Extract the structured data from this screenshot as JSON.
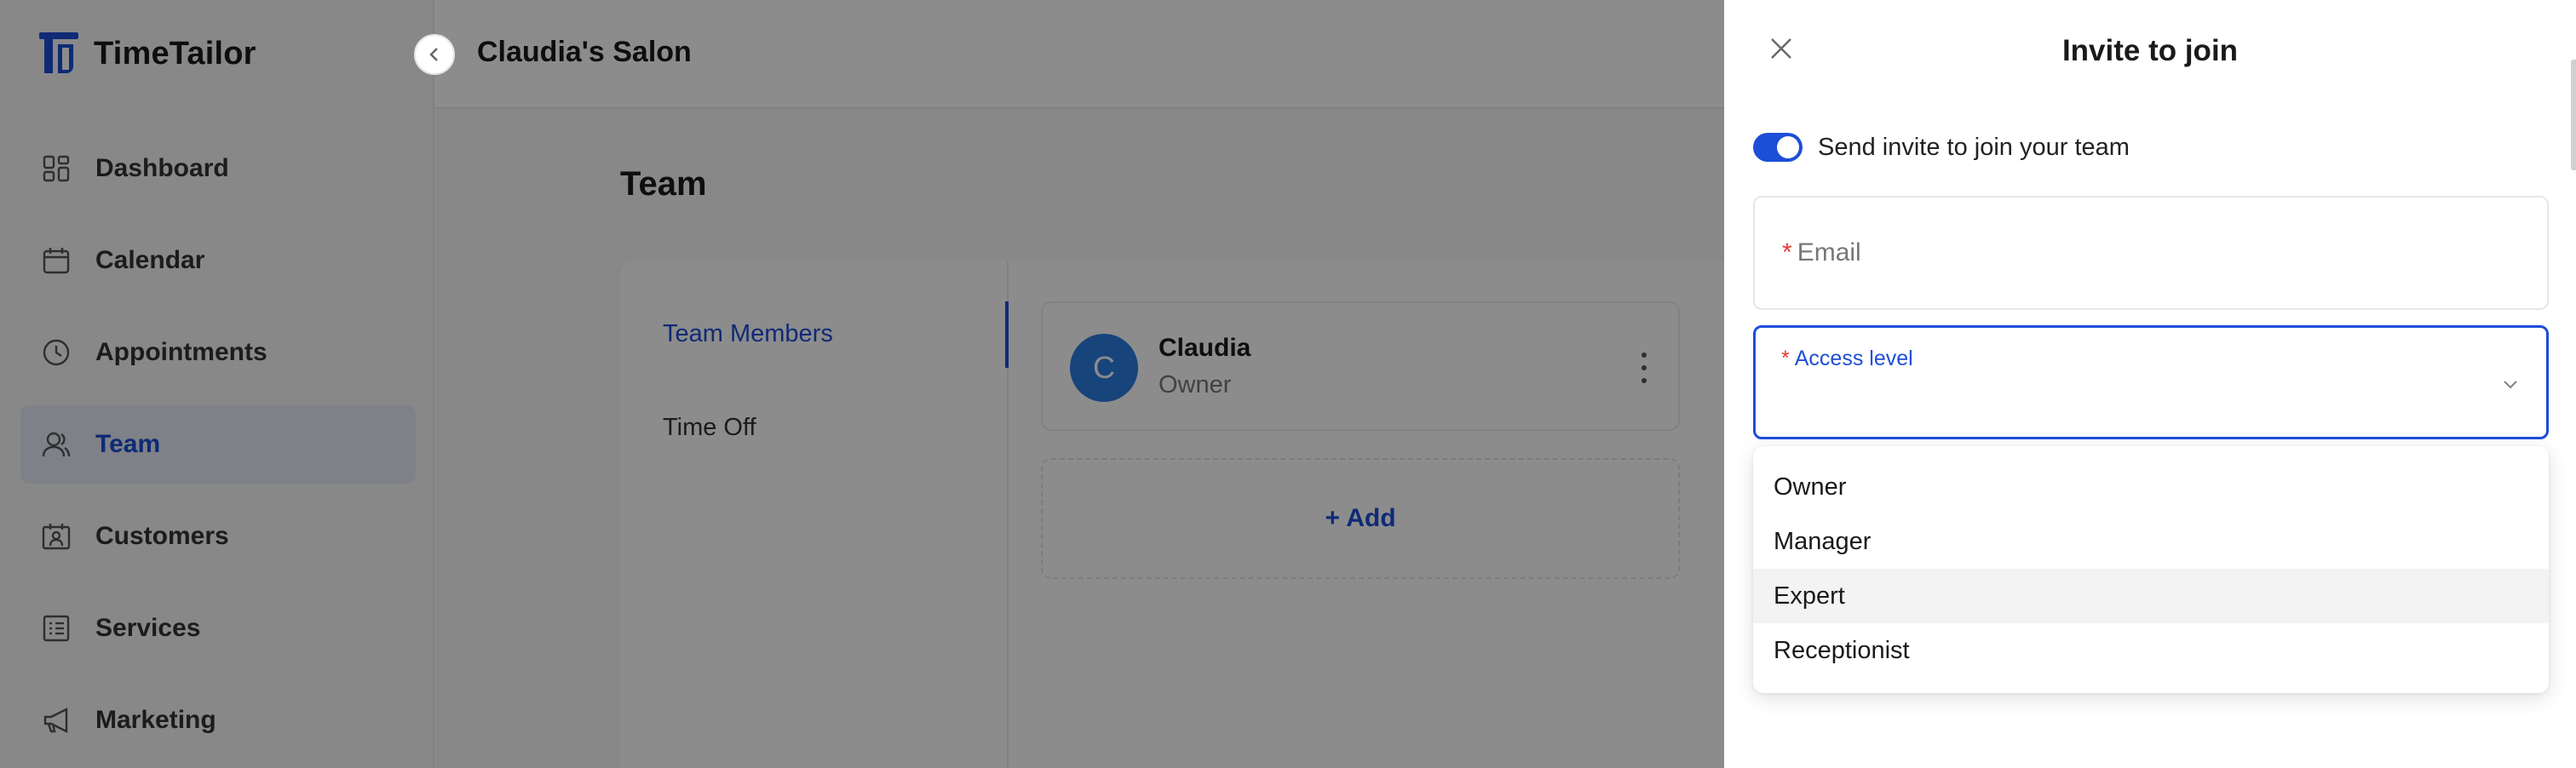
{
  "brand": {
    "name": "TimeTailor"
  },
  "header": {
    "title": "Claudia's Salon"
  },
  "sidebar": {
    "items": [
      {
        "label": "Dashboard",
        "icon": "dashboard-icon",
        "active": false
      },
      {
        "label": "Calendar",
        "icon": "calendar-icon",
        "active": false
      },
      {
        "label": "Appointments",
        "icon": "clock-icon",
        "active": false
      },
      {
        "label": "Team",
        "icon": "team-icon",
        "active": true
      },
      {
        "label": "Customers",
        "icon": "customers-icon",
        "active": false
      },
      {
        "label": "Services",
        "icon": "services-icon",
        "active": false
      },
      {
        "label": "Marketing",
        "icon": "megaphone-icon",
        "active": false
      }
    ]
  },
  "main": {
    "page_title": "Team",
    "tabs": [
      {
        "label": "Team Members",
        "active": true
      },
      {
        "label": "Time Off",
        "active": false
      }
    ],
    "member": {
      "initial": "C",
      "name": "Claudia",
      "role": "Owner"
    },
    "add_label": "+ Add"
  },
  "drawer": {
    "title": "Invite to join",
    "toggle_label": "Send invite to join your team",
    "toggle_on": true,
    "email_label": "Email",
    "access_label": "Access level",
    "required_mark": "*",
    "options": [
      "Owner",
      "Manager",
      "Expert",
      "Receptionist"
    ],
    "highlighted_option": "Expert"
  },
  "colors": {
    "accent": "#1d4ed8",
    "avatar": "#2a7de1",
    "required": "#e53935",
    "overlay": "rgba(0,0,0,0.45)"
  }
}
